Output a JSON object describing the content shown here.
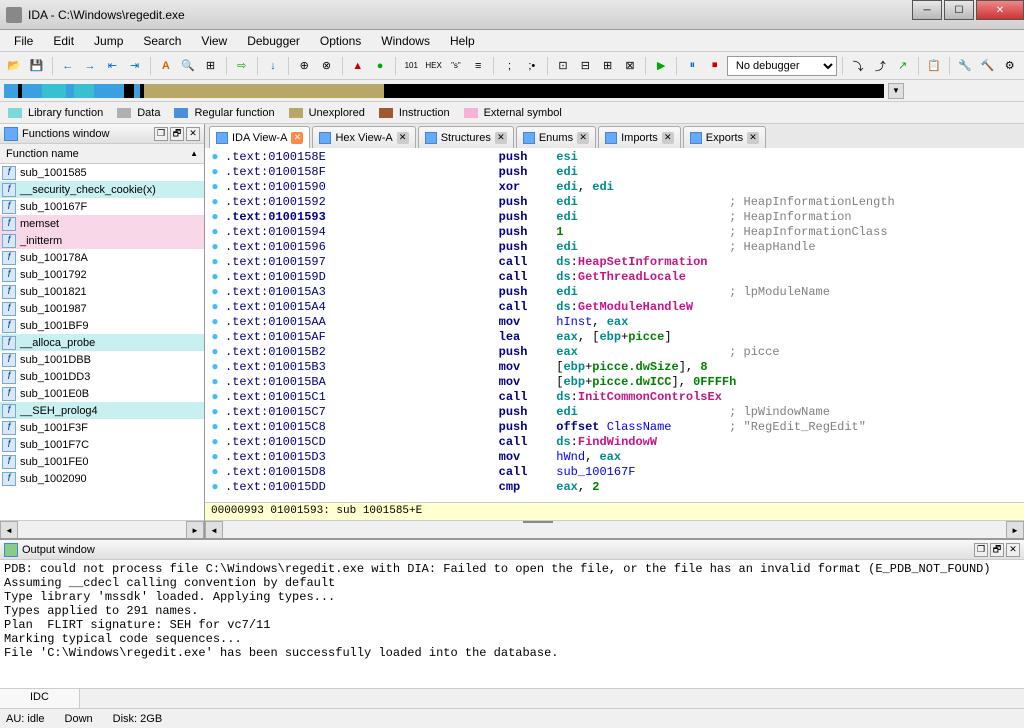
{
  "window": {
    "title": "IDA - C:\\Windows\\regedit.exe"
  },
  "menubar": [
    "File",
    "Edit",
    "Jump",
    "Search",
    "View",
    "Debugger",
    "Options",
    "Windows",
    "Help"
  ],
  "debugger_combo": "No debugger",
  "legend": [
    {
      "color": "#7fd8d8",
      "label": "Library function"
    },
    {
      "color": "#b0b0b0",
      "label": "Data"
    },
    {
      "color": "#4a90d9",
      "label": "Regular function"
    },
    {
      "color": "#b8a868",
      "label": "Unexplored"
    },
    {
      "color": "#a05830",
      "label": "Instruction"
    },
    {
      "color": "#f8b0d8",
      "label": "External symbol"
    }
  ],
  "functions_panel": {
    "title": "Functions window",
    "column": "Function name",
    "items": [
      {
        "name": "sub_1001585",
        "hl": ""
      },
      {
        "name": "__security_check_cookie(x)",
        "hl": "cyan"
      },
      {
        "name": "sub_100167F",
        "hl": ""
      },
      {
        "name": "memset",
        "hl": "pink"
      },
      {
        "name": "_initterm",
        "hl": "pink"
      },
      {
        "name": "sub_100178A",
        "hl": ""
      },
      {
        "name": "sub_1001792",
        "hl": ""
      },
      {
        "name": "sub_1001821",
        "hl": ""
      },
      {
        "name": "sub_1001987",
        "hl": ""
      },
      {
        "name": "sub_1001BF9",
        "hl": ""
      },
      {
        "name": "__alloca_probe",
        "hl": "cyan"
      },
      {
        "name": "sub_1001DBB",
        "hl": ""
      },
      {
        "name": "sub_1001DD3",
        "hl": ""
      },
      {
        "name": "sub_1001E0B",
        "hl": ""
      },
      {
        "name": "__SEH_prolog4",
        "hl": "cyan"
      },
      {
        "name": "sub_1001F3F",
        "hl": ""
      },
      {
        "name": "sub_1001F7C",
        "hl": ""
      },
      {
        "name": "sub_1001FE0",
        "hl": ""
      },
      {
        "name": "sub_1002090",
        "hl": ""
      }
    ]
  },
  "tabs": [
    {
      "icon": "view",
      "label": "IDA View-A",
      "active": true,
      "close": "orange"
    },
    {
      "icon": "hex",
      "label": "Hex View-A",
      "active": false,
      "close": "grey"
    },
    {
      "icon": "struct",
      "label": "Structures",
      "active": false,
      "close": "grey"
    },
    {
      "icon": "enum",
      "label": "Enums",
      "active": false,
      "close": "grey"
    },
    {
      "icon": "import",
      "label": "Imports",
      "active": false,
      "close": "grey"
    },
    {
      "icon": "export",
      "label": "Exports",
      "active": false,
      "close": "grey"
    }
  ],
  "disasm": {
    "lines": [
      {
        "addr": ".text:0100158E",
        "mnem": "push",
        "ops": [
          {
            "t": "reg",
            "v": "esi"
          }
        ]
      },
      {
        "addr": ".text:0100158F",
        "mnem": "push",
        "ops": [
          {
            "t": "reg",
            "v": "edi"
          }
        ]
      },
      {
        "addr": ".text:01001590",
        "mnem": "xor",
        "ops": [
          {
            "t": "reg",
            "v": "edi"
          },
          {
            "t": "txt",
            "v": ", "
          },
          {
            "t": "reg",
            "v": "edi"
          }
        ]
      },
      {
        "addr": ".text:01001592",
        "mnem": "push",
        "ops": [
          {
            "t": "reg",
            "v": "edi"
          }
        ],
        "comment": "; HeapInformationLength"
      },
      {
        "addr": ".text:01001593",
        "addr_style": "blue",
        "mnem": "push",
        "ops": [
          {
            "t": "reg",
            "v": "edi"
          }
        ],
        "comment": "; HeapInformation"
      },
      {
        "addr": ".text:01001594",
        "mnem": "push",
        "ops": [
          {
            "t": "num",
            "v": "1"
          }
        ],
        "comment": "; HeapInformationClass"
      },
      {
        "addr": ".text:01001596",
        "mnem": "push",
        "ops": [
          {
            "t": "reg",
            "v": "edi"
          }
        ],
        "comment": "; HeapHandle"
      },
      {
        "addr": ".text:01001597",
        "mnem": "call",
        "ops": [
          {
            "t": "reg",
            "v": "ds"
          },
          {
            "t": "txt",
            "v": ":"
          },
          {
            "t": "pink",
            "v": "HeapSetInformation"
          }
        ]
      },
      {
        "addr": ".text:0100159D",
        "mnem": "call",
        "ops": [
          {
            "t": "reg",
            "v": "ds"
          },
          {
            "t": "txt",
            "v": ":"
          },
          {
            "t": "pink",
            "v": "GetThreadLocale"
          }
        ]
      },
      {
        "addr": ".text:010015A3",
        "mnem": "push",
        "ops": [
          {
            "t": "reg",
            "v": "edi"
          }
        ],
        "comment": "; lpModuleName"
      },
      {
        "addr": ".text:010015A4",
        "mnem": "call",
        "ops": [
          {
            "t": "reg",
            "v": "ds"
          },
          {
            "t": "txt",
            "v": ":"
          },
          {
            "t": "pink",
            "v": "GetModuleHandleW"
          }
        ]
      },
      {
        "addr": ".text:010015AA",
        "mnem": "mov",
        "ops": [
          {
            "t": "ident",
            "v": "hInst"
          },
          {
            "t": "txt",
            "v": ", "
          },
          {
            "t": "reg",
            "v": "eax"
          }
        ]
      },
      {
        "addr": ".text:010015AF",
        "mnem": "lea",
        "ops": [
          {
            "t": "reg",
            "v": "eax"
          },
          {
            "t": "txt",
            "v": ", ["
          },
          {
            "t": "reg",
            "v": "ebp"
          },
          {
            "t": "txt",
            "v": "+"
          },
          {
            "t": "label",
            "v": "picce"
          },
          {
            "t": "txt",
            "v": "]"
          }
        ]
      },
      {
        "addr": ".text:010015B2",
        "mnem": "push",
        "ops": [
          {
            "t": "reg",
            "v": "eax"
          }
        ],
        "comment": "; picce"
      },
      {
        "addr": ".text:010015B3",
        "mnem": "mov",
        "ops": [
          {
            "t": "txt",
            "v": "["
          },
          {
            "t": "reg",
            "v": "ebp"
          },
          {
            "t": "txt",
            "v": "+"
          },
          {
            "t": "label",
            "v": "picce.dwSize"
          },
          {
            "t": "txt",
            "v": "], "
          },
          {
            "t": "num",
            "v": "8"
          }
        ]
      },
      {
        "addr": ".text:010015BA",
        "mnem": "mov",
        "ops": [
          {
            "t": "txt",
            "v": "["
          },
          {
            "t": "reg",
            "v": "ebp"
          },
          {
            "t": "txt",
            "v": "+"
          },
          {
            "t": "label",
            "v": "picce.dwICC"
          },
          {
            "t": "txt",
            "v": "], "
          },
          {
            "t": "num",
            "v": "0FFFFh"
          }
        ]
      },
      {
        "addr": ".text:010015C1",
        "mnem": "call",
        "ops": [
          {
            "t": "reg",
            "v": "ds"
          },
          {
            "t": "txt",
            "v": ":"
          },
          {
            "t": "pink",
            "v": "InitCommonControlsEx"
          }
        ]
      },
      {
        "addr": ".text:010015C7",
        "mnem": "push",
        "ops": [
          {
            "t": "reg",
            "v": "edi"
          }
        ],
        "comment": "; lpWindowName"
      },
      {
        "addr": ".text:010015C8",
        "mnem": "push",
        "ops": [
          {
            "t": "mnem",
            "v": "offset "
          },
          {
            "t": "ident",
            "v": "ClassName"
          }
        ],
        "comment": "; \"RegEdit_RegEdit\""
      },
      {
        "addr": ".text:010015CD",
        "mnem": "call",
        "ops": [
          {
            "t": "reg",
            "v": "ds"
          },
          {
            "t": "txt",
            "v": ":"
          },
          {
            "t": "pink",
            "v": "FindWindowW"
          }
        ]
      },
      {
        "addr": ".text:010015D3",
        "mnem": "mov",
        "ops": [
          {
            "t": "ident",
            "v": "hWnd"
          },
          {
            "t": "txt",
            "v": ", "
          },
          {
            "t": "reg",
            "v": "eax"
          }
        ]
      },
      {
        "addr": ".text:010015D8",
        "mnem": "call",
        "ops": [
          {
            "t": "ident",
            "v": "sub_100167F"
          }
        ]
      },
      {
        "addr": ".text:010015DD",
        "mnem": "cmp",
        "ops": [
          {
            "t": "reg",
            "v": "eax"
          },
          {
            "t": "txt",
            "v": ", "
          },
          {
            "t": "num",
            "v": "2"
          }
        ]
      }
    ],
    "status": "00000993 01001593: sub 1001585+E"
  },
  "output": {
    "title": "Output window",
    "lines": [
      "PDB: could not process file C:\\Windows\\regedit.exe with DIA: Failed to open the file, or the file has an invalid format (E_PDB_NOT_FOUND)",
      "Assuming __cdecl calling convention by default",
      "Type library 'mssdk' loaded. Applying types...",
      "Types applied to 291 names.",
      "Plan  FLIRT signature: SEH for vc7/11",
      "Marking typical code sequences...",
      "File 'C:\\Windows\\regedit.exe' has been successfully loaded into the database."
    ],
    "tab": "IDC"
  },
  "statusbar": {
    "au": "AU:  idle",
    "down": "Down",
    "disk": "Disk: 2GB"
  }
}
